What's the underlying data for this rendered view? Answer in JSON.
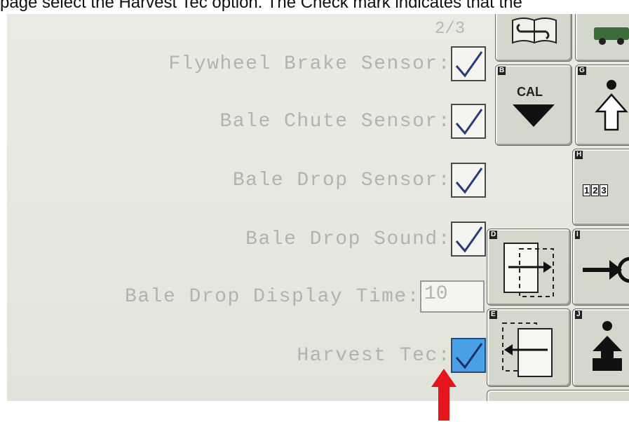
{
  "caption": "page select the Harvest Tec option. The Check mark indicates that the",
  "page_indicator": "2/3",
  "settings": [
    {
      "label": "Flywheel Brake Sensor:",
      "checked": true
    },
    {
      "label": "Bale Chute Sensor:",
      "checked": true
    },
    {
      "label": "Bale Drop Sensor:",
      "checked": true
    },
    {
      "label": "Bale Drop Sound:",
      "checked": true
    }
  ],
  "display_time": {
    "label": "Bale Drop Display Time:",
    "value": "10"
  },
  "harvest_tec": {
    "label": "Harvest Tec:",
    "checked": true,
    "selected": true
  },
  "buttons": {
    "b_key": "B",
    "cal_label": "CAL",
    "g_key": "G",
    "h_key": "H",
    "h_label": [
      "1",
      "2",
      "3"
    ],
    "d_key": "D",
    "i_key": "I",
    "e_key": "E",
    "j_key": "J"
  },
  "colors": {
    "selected_checkbox": "#4aa0e6",
    "pointer_arrow": "#e8141c",
    "screen_bg": "#e8eae2"
  },
  "icons": [
    "manual-wrench-icon",
    "baler-icon",
    "cal-down-arrow-icon",
    "up-arrow-icon",
    "numeric-keypad-icon",
    "move-right-icon",
    "arrow-right-icon",
    "move-left-icon",
    "up-arrow-filled-icon",
    "red-pointer-arrow-icon"
  ]
}
